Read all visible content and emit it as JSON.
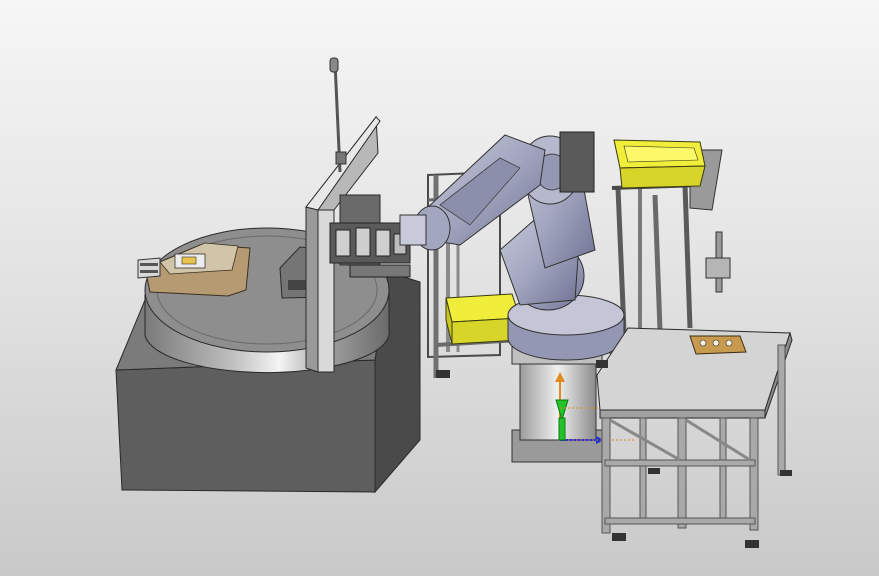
{
  "viewport": {
    "background_top": "#f6f6f6",
    "background_bottom": "#c9c9c9"
  },
  "scene": {
    "rotary_table": {
      "body_color": "#5e5e5e",
      "top_color": "#8e8e8e"
    },
    "fixture_plate": {
      "color": "#b59a72"
    },
    "robot": {
      "color": "#a4a7bf",
      "dark_color": "#6d7091"
    },
    "left_bin": {
      "color": "#f0ee3a"
    },
    "right_bin": {
      "color": "#f0ee3a"
    },
    "work_table": {
      "top_color": "#d4d4d4",
      "frame_color": "#a9a9a9"
    },
    "part_tray": {
      "color": "#c89a50"
    },
    "coordinate_triad": {
      "x_color": "#2030d0",
      "y_color": "#22c22a",
      "z_color": "#e08a20"
    }
  }
}
